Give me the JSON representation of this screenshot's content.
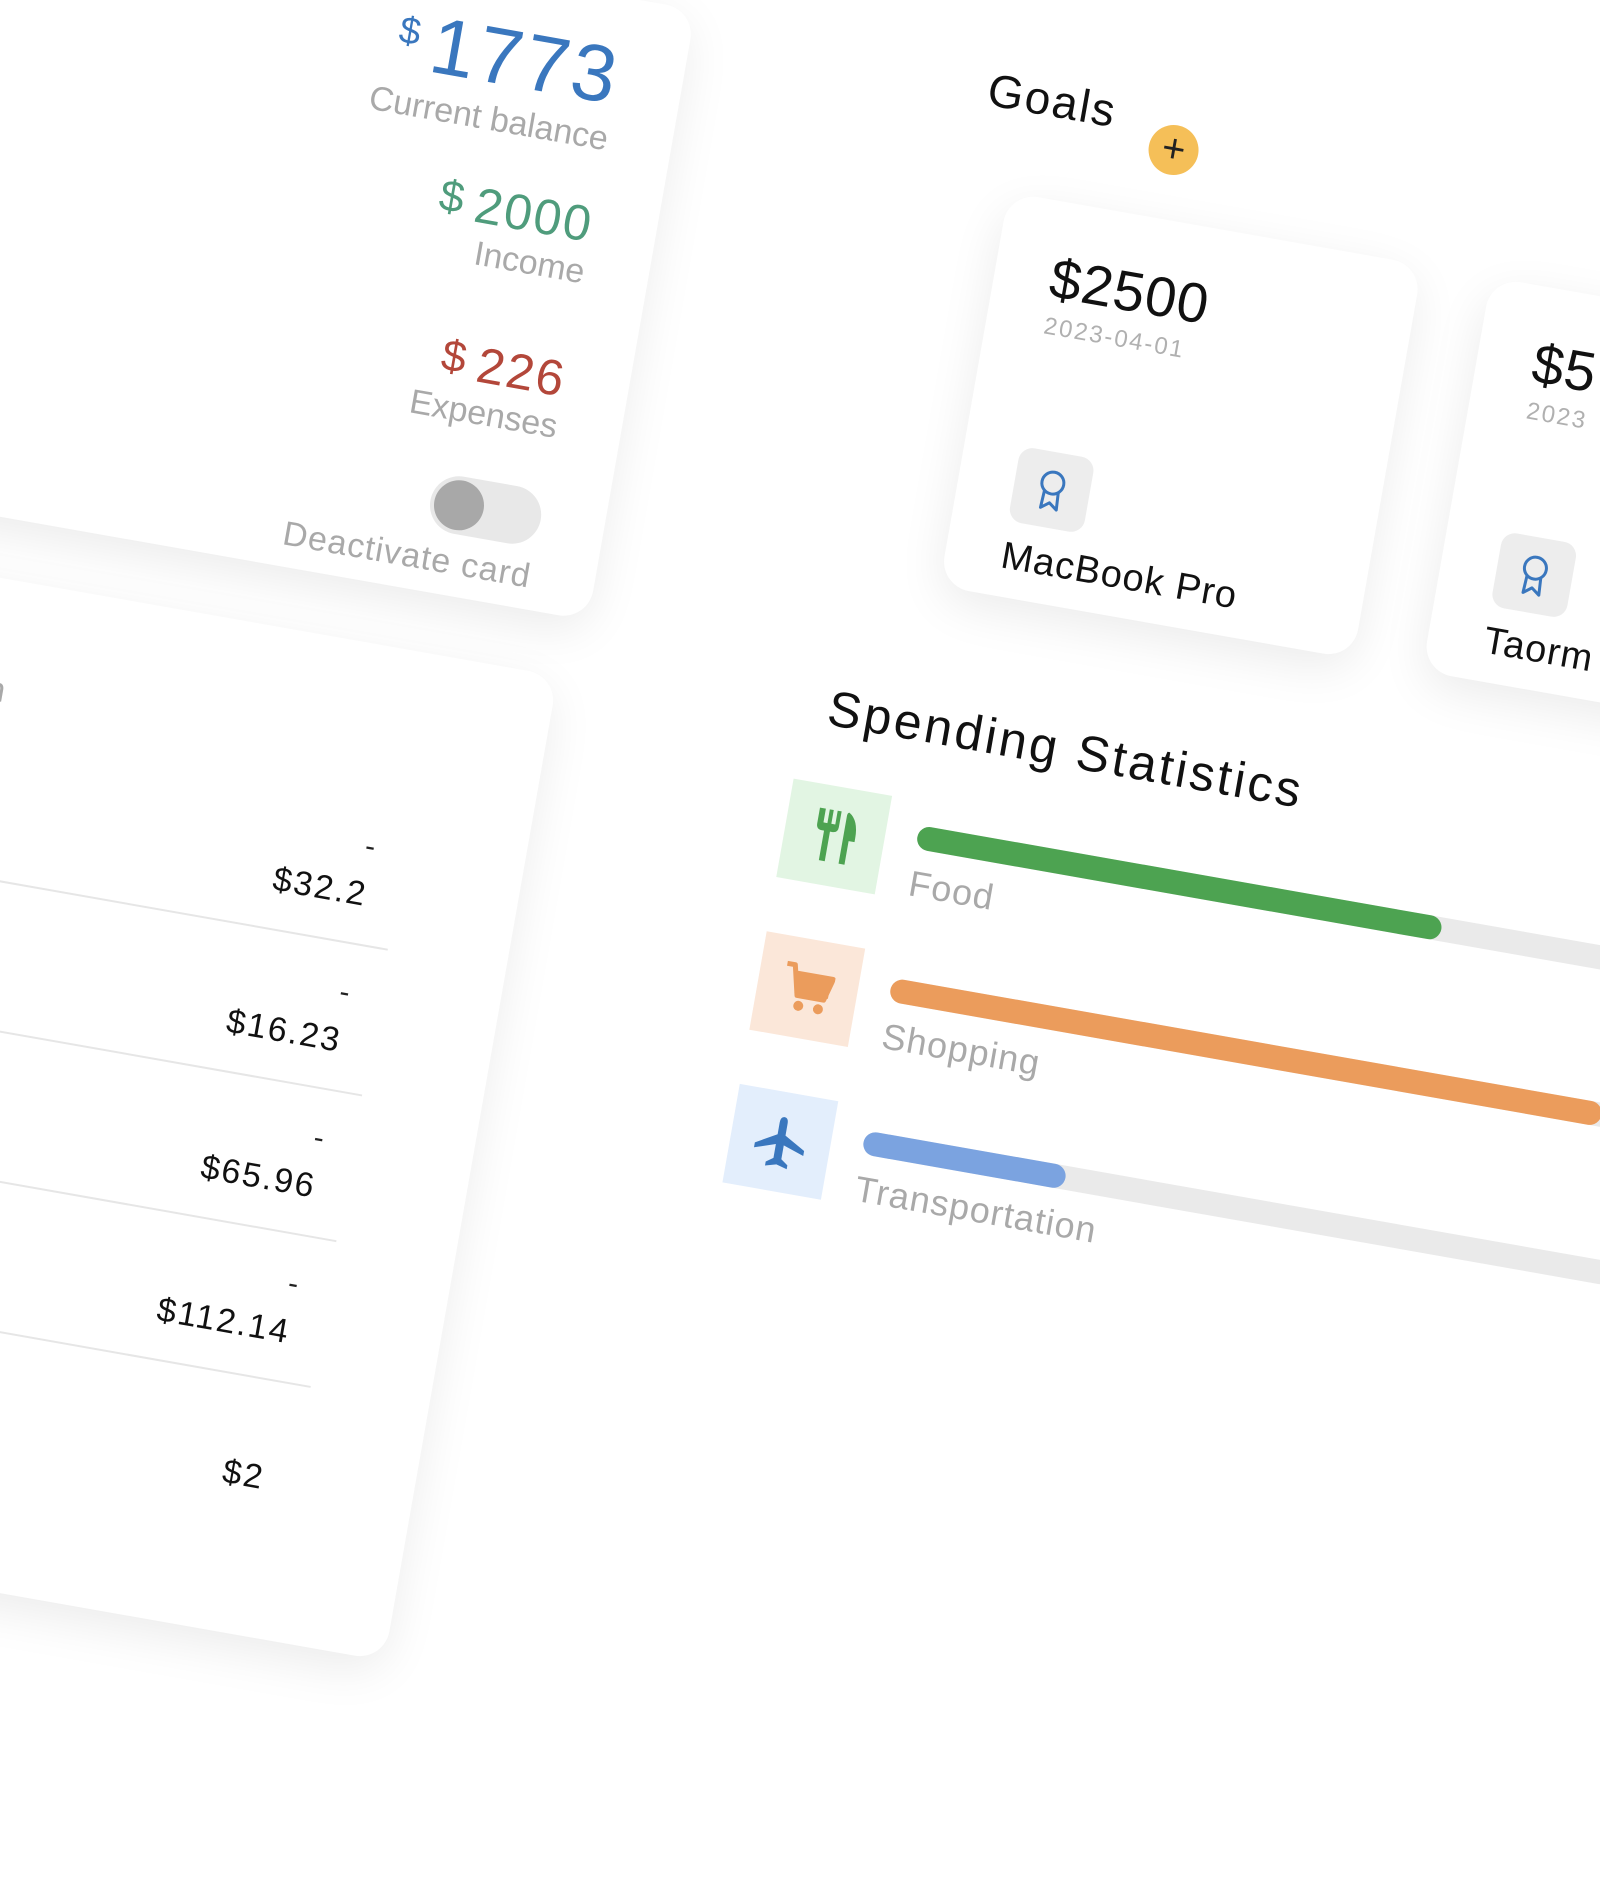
{
  "balance": {
    "currency_symbol": "$",
    "current_value": "1773",
    "current_label": "Current balance",
    "income_value": "2000",
    "income_label": "Income",
    "expenses_value": "226",
    "expenses_label": "Expenses",
    "toggle_label": "Deactivate card",
    "toggle_on": false,
    "colors": {
      "balance": "#3a77be",
      "income": "#4f9c7c",
      "expenses": "#b3473a"
    }
  },
  "transactions": {
    "filter_label": "sportation",
    "rows": [
      {
        "sign": "-",
        "amount": "$32.2"
      },
      {
        "sign": "-",
        "amount": "$16.23"
      },
      {
        "sign": "-",
        "amount": "$65.96"
      },
      {
        "sign": "-",
        "amount": "$112.14"
      },
      {
        "sign": "",
        "amount": "$2"
      }
    ]
  },
  "goals": {
    "title": "Goals",
    "add_icon": "plus-icon",
    "add_label": "+",
    "items": [
      {
        "amount": "$2500",
        "date": "2023-04-01",
        "name": "MacBook Pro",
        "icon": "award-icon"
      },
      {
        "amount": "$5",
        "date": "2023",
        "name": "Taorm",
        "icon": "award-icon"
      }
    ]
  },
  "stats": {
    "title": "Spending Statistics",
    "items": [
      {
        "label": "Food",
        "icon": "utensils-icon",
        "level": 0.7,
        "color": "#4da351",
        "bg": "#e2f5e3"
      },
      {
        "label": "Shopping",
        "icon": "cart-icon",
        "level": 0.95,
        "color": "#eb9c5c",
        "bg": "#fbe7d9"
      },
      {
        "label": "Transportation",
        "icon": "plane-icon",
        "level": 0.27,
        "color": "#7ba3e0",
        "bg": "#e3eefc"
      }
    ]
  }
}
